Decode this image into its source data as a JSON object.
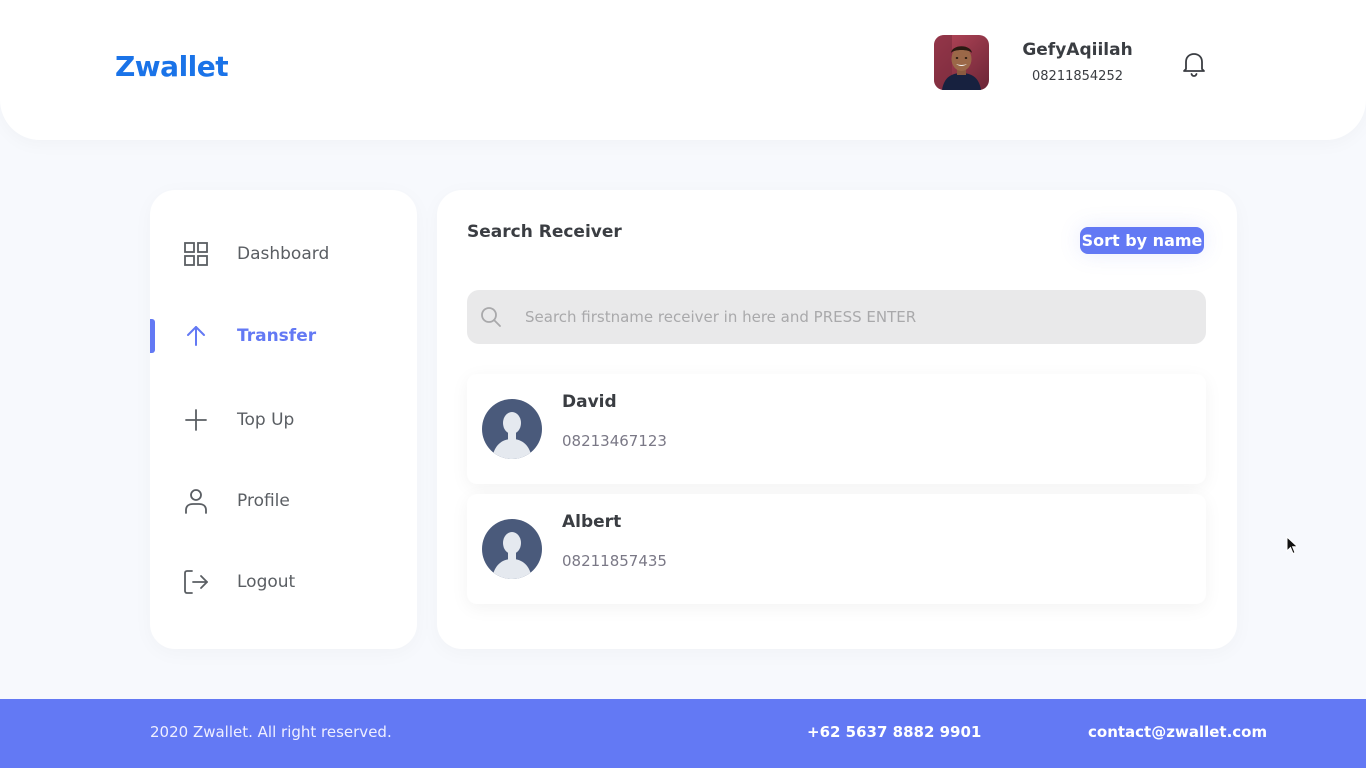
{
  "header": {
    "brand": "Zwallet",
    "user": {
      "name": "GefyAqiilah",
      "phone": "08211854252"
    },
    "icons": {
      "notification": "bell-icon"
    }
  },
  "sidebar": {
    "items": [
      {
        "label": "Dashboard",
        "icon": "grid-icon",
        "active": false
      },
      {
        "label": "Transfer",
        "icon": "arrow-up-icon",
        "active": true
      },
      {
        "label": "Top Up",
        "icon": "plus-icon",
        "active": false
      },
      {
        "label": "Profile",
        "icon": "user-icon",
        "active": false
      },
      {
        "label": "Logout",
        "icon": "logout-icon",
        "active": false
      }
    ]
  },
  "main": {
    "title": "Search Receiver",
    "sort_label": "Sort by name",
    "search": {
      "placeholder": "Search firstname receiver in here and PRESS ENTER",
      "value": ""
    },
    "receivers": [
      {
        "name": "David",
        "phone": "08213467123"
      },
      {
        "name": "Albert",
        "phone": "08211857435"
      }
    ]
  },
  "footer": {
    "copyright": "2020 Zwallet. All right reserved.",
    "phone": "+62 5637 8882 9901",
    "email": "contact@zwallet.com"
  },
  "colors": {
    "primary": "#6379F4",
    "brand": "#1A73E8",
    "background": "#F7F9FD",
    "search_bg": "#E9E9EA"
  }
}
